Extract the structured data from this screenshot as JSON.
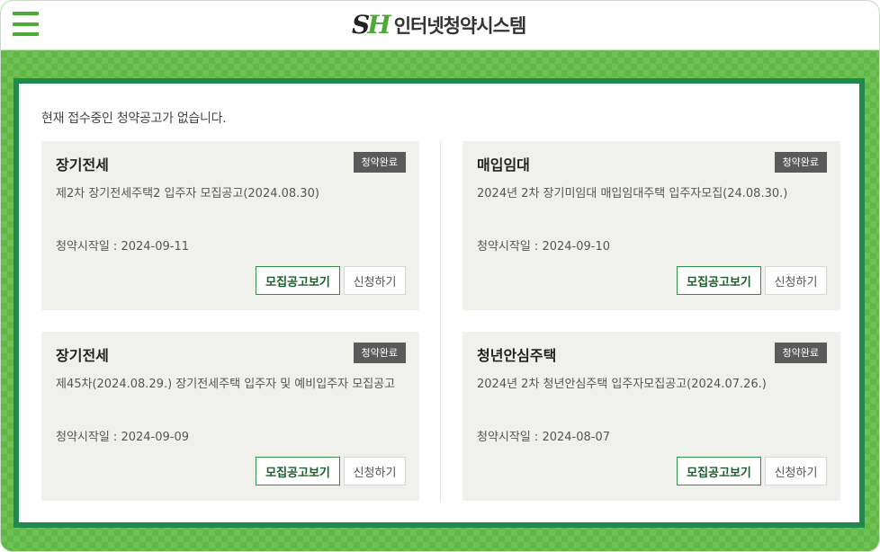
{
  "header": {
    "logo_s": "S",
    "logo_h": "H",
    "title": "인터넷청약시스템"
  },
  "notice": "현재 접수중인 청약공고가 없습니다.",
  "cards": [
    {
      "title": "장기전세",
      "badge": "청약완료",
      "description": "제2차 장기전세주택2 입주자 모집공고(2024.08.30)",
      "date": "청약시작일 : 2024-09-11",
      "view_label": "모집공고보기",
      "apply_label": "신청하기"
    },
    {
      "title": "매입임대",
      "badge": "청약완료",
      "description": "2024년 2차 장기미임대 매입임대주택 입주자모집(24.08.30.)",
      "date": "청약시작일 : 2024-09-10",
      "view_label": "모집공고보기",
      "apply_label": "신청하기"
    },
    {
      "title": "장기전세",
      "badge": "청약완료",
      "description": "제45차(2024.08.29.) 장기전세주택 입주자 및 예비입주자 모집공고",
      "date": "청약시작일 : 2024-09-09",
      "view_label": "모집공고보기",
      "apply_label": "신청하기"
    },
    {
      "title": "청년안심주택",
      "badge": "청약완료",
      "description": "2024년 2차 청년안심주택 입주자모집공고(2024.07.26.)",
      "date": "청약시작일 : 2024-08-07",
      "view_label": "모집공고보기",
      "apply_label": "신청하기"
    }
  ],
  "colors": {
    "brand_green": "#4bab36",
    "panel_border": "#1f8a4c",
    "badge_bg": "#5a5a5a"
  }
}
